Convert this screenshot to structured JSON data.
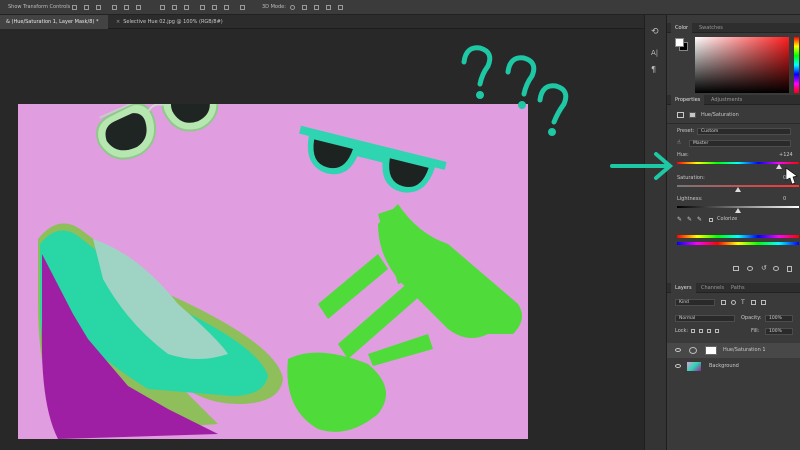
{
  "options_bar": {
    "label": "Show Transform Controls"
  },
  "tabs": [
    {
      "label": "& (Hue/Saturation 1, Layer Mask/8) *",
      "active": true
    },
    {
      "label": "Selective Hue 02.jpg @ 100% (RGB/8#)",
      "active": false
    }
  ],
  "color_panel": {
    "tabs": [
      "Color",
      "Swatches"
    ],
    "fg": "#ffffff",
    "bg": "#000000"
  },
  "properties_panel": {
    "tabs": [
      "Properties",
      "Adjustments"
    ],
    "adjustment_name": "Hue/Saturation",
    "preset_label": "Preset:",
    "preset_value": "Custom",
    "channel_value": "Master",
    "hue_label": "Hue:",
    "hue_value": "+124",
    "hue_fraction": 0.84,
    "saturation_label": "Saturation:",
    "saturation_value": "0",
    "lightness_label": "Lightness:",
    "lightness_value": "0",
    "colorize_label": "Colorize"
  },
  "layers_panel": {
    "tabs": [
      "Layers",
      "Channels",
      "Paths"
    ],
    "kind_value": "Kind",
    "blend_mode": "Normal",
    "opacity_label": "Opacity:",
    "opacity_value": "100%",
    "lock_label": "Lock:",
    "fill_label": "Fill:",
    "fill_value": "100%",
    "layers": [
      {
        "name": "Hue/Saturation 1"
      },
      {
        "name": "Background"
      }
    ]
  },
  "colors": {
    "accent_arrow": "#1ec8a5",
    "photo_bg": "#e09de0"
  }
}
